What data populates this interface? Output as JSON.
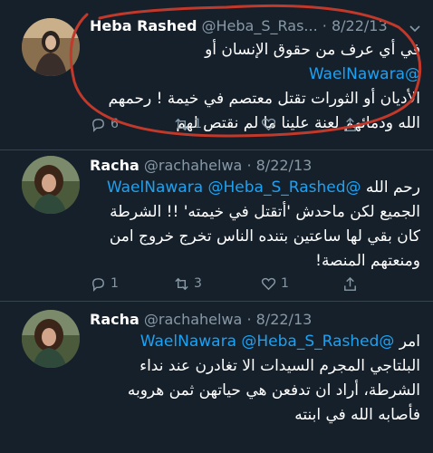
{
  "tweets": [
    {
      "name": "Heba Rashed",
      "handle": "@Heba_S_Ras...",
      "dot": "·",
      "date": "8/22/13",
      "mention": "@WaelNawara",
      "text_lines": [
        "في أي عرف من حقوق الإنسان أو",
        "الأديان  أو الثورات تقتل معتصم في خيمة ! رحمهم",
        "الله ودمائهم لعنة علينا ما لم نقتص لهم"
      ],
      "replies": "6",
      "retweets": "1",
      "likes": ""
    },
    {
      "name": "Racha",
      "handle": "@rachahelwa",
      "dot": "·",
      "date": "8/22/13",
      "mention": "@WaelNawara @Heba_S_Rashed",
      "text_lines": [
        "رحم الله",
        "الجميع لكن ماحدش 'أتقتل في خيمته' !! الشرطة",
        "كان بقي لها ساعتين بتنده الناس تخرج خروج امن",
        "ومنعتهم المنصة!"
      ],
      "replies": "1",
      "retweets": "3",
      "likes": "1"
    },
    {
      "name": "Racha",
      "handle": "@rachahelwa",
      "dot": "·",
      "date": "8/22/13",
      "mention": "@WaelNawara @Heba_S_Rashed",
      "text_lines": [
        "امر",
        "البلتاجي المجرم السيدات الا تغادرن عند نداء",
        "الشرطة، أراد ان تدفعن هي حياتهن ثمن هروبه",
        "فأصابه الله في ابنته"
      ]
    }
  ],
  "icons": {
    "reply": "reply-icon",
    "retweet": "retweet-icon",
    "like": "heart-icon",
    "share": "share-icon",
    "more": "chevron-down-icon"
  },
  "colors": {
    "background": "#15202b",
    "text": "#ffffff",
    "secondary": "#8899a6",
    "link": "#1da1f2",
    "annotation": "#c0392b"
  }
}
